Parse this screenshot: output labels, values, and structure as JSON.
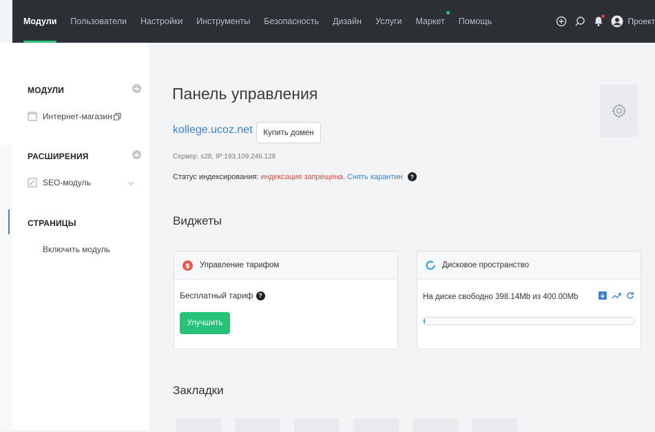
{
  "nav": {
    "items": [
      {
        "label": "Модули",
        "active": true
      },
      {
        "label": "Пользователи"
      },
      {
        "label": "Настройки"
      },
      {
        "label": "Инструменты"
      },
      {
        "label": "Безопасность"
      },
      {
        "label": "Дизайн"
      },
      {
        "label": "Услуги"
      },
      {
        "label": "Маркет",
        "dot": true
      },
      {
        "label": "Помощь"
      }
    ],
    "project_label": "Проект",
    "icons": [
      "plus-circle-icon",
      "search-icon",
      "bell-icon",
      "user-avatar-icon"
    ]
  },
  "sidebar": {
    "modules_heading": "МОДУЛИ",
    "shop_item": "Интернет-магазин",
    "extensions_heading": "РАСШИРЕНИЯ",
    "seo_item": "SEO-модуль",
    "pages_heading": "СТРАНИЦЫ",
    "enable_module": "Включить модуль"
  },
  "main": {
    "title": "Панель управления",
    "domain": "kollege.ucoz.net",
    "buy_domain": "Купить домен",
    "server_info": "Сервер: s28, IP:193.109.246.128",
    "index_status_label": "Статус индексирования:",
    "index_status_value": "индексация запрещена.",
    "remove_quarantine": "Снять карантин",
    "widgets_title": "Виджеты",
    "bookmarks_title": "Закладки"
  },
  "tariff_widget": {
    "title": "Управление тарифом",
    "plan": "Бесплатный тариф",
    "upgrade": "Улучшить"
  },
  "disk_widget": {
    "title": "Дисковое пространство",
    "text": "На диске свободно 398.14Mb из 400.00Mb",
    "used_fraction": 0.0047
  },
  "colors": {
    "topbar": "#2c2f34",
    "accent_green": "#25c278",
    "link_blue": "#3f7ec9",
    "warning_red": "#e0463f"
  }
}
